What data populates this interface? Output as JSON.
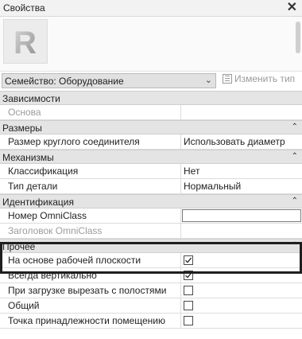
{
  "panel": {
    "title": "Свойства",
    "close_glyph": "✕"
  },
  "preview": {
    "logo_letter": "R"
  },
  "type_selector": {
    "value": "Семейство: Оборудование",
    "edit_type_label": "Изменить тип"
  },
  "categories": [
    {
      "label": "Зависимости",
      "caret": "",
      "rows": [
        {
          "name": "Основа",
          "value": "",
          "kind": "text",
          "dim": true
        }
      ]
    },
    {
      "label": "Размеры",
      "caret": "⌃",
      "rows": [
        {
          "name": "Размер круглого соединителя",
          "value": "Использовать диаметр",
          "kind": "text"
        }
      ]
    },
    {
      "label": "Механизмы",
      "caret": "⌃",
      "rows": [
        {
          "name": "Классификация",
          "value": "Нет",
          "kind": "text"
        },
        {
          "name": "Тип детали",
          "value": "Нормальный",
          "kind": "text"
        }
      ]
    },
    {
      "label": "Идентификация",
      "caret": "⌃",
      "rows": [
        {
          "name": "Номер OmniClass",
          "value": "",
          "kind": "input"
        },
        {
          "name": "Заголовок OmniClass",
          "value": "",
          "kind": "text",
          "dim": true
        }
      ]
    },
    {
      "label": "Прочее",
      "caret": "⌃",
      "rows": [
        {
          "name": "На основе рабочей плоскости",
          "kind": "checkbox",
          "checked": true
        },
        {
          "name": "Всегда вертикально",
          "kind": "checkbox",
          "checked": true
        },
        {
          "name": "При загрузке вырезать с полостями",
          "kind": "checkbox",
          "checked": false
        },
        {
          "name": "Общий",
          "kind": "checkbox",
          "checked": false
        },
        {
          "name": "Точка принадлежности помещению",
          "kind": "checkbox",
          "checked": false
        }
      ]
    }
  ]
}
